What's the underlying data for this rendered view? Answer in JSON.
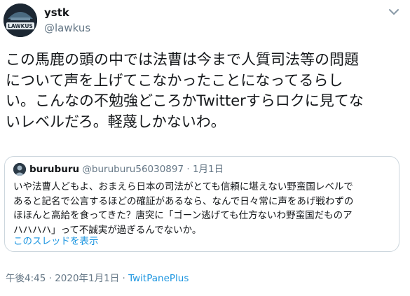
{
  "author": {
    "name": "ystk",
    "handle": "@lawkus",
    "avatar_label": "LAWKUS",
    "avatar_icon": "hat-avatar-icon"
  },
  "tweet": {
    "text": "この馬鹿の頭の中では法曹は今まで人質司法等の問題\nについて声を上げてこなかったことになってるらし\nい。こんなの不勉強どころかTwitterすらロクに見てな\nいレベルだろ。軽蔑しかないわ。",
    "menu_icon": "chevron-down-icon"
  },
  "quoted": {
    "name": "buruburu",
    "handle": "@buruburu56030897",
    "separator": "·",
    "date": "1月1日",
    "text": "いや法曹人どもよ、おまえら日本の司法がとても信頼に堪えない野蛮国レベルで\nあると記名で公言するほどの確証があるなら、なんで日々常に声をあげ戦わずの\nほほんと高給を食ってきた？唐突に「ゴーン逃げても仕方ないわ野蛮国だものア\nハハハハ」って不誠実が過ぎるんでないか。",
    "thread_link": "このスレッドを表示"
  },
  "meta": {
    "time": "午後4:45",
    "separator1": " · ",
    "date": "2020年1月1日",
    "separator2": " · ",
    "source": "TwitPanePlus"
  },
  "colors": {
    "text": "#14171a",
    "secondary": "#657786",
    "link": "#1b95e0",
    "border": "#ccd6dd"
  }
}
